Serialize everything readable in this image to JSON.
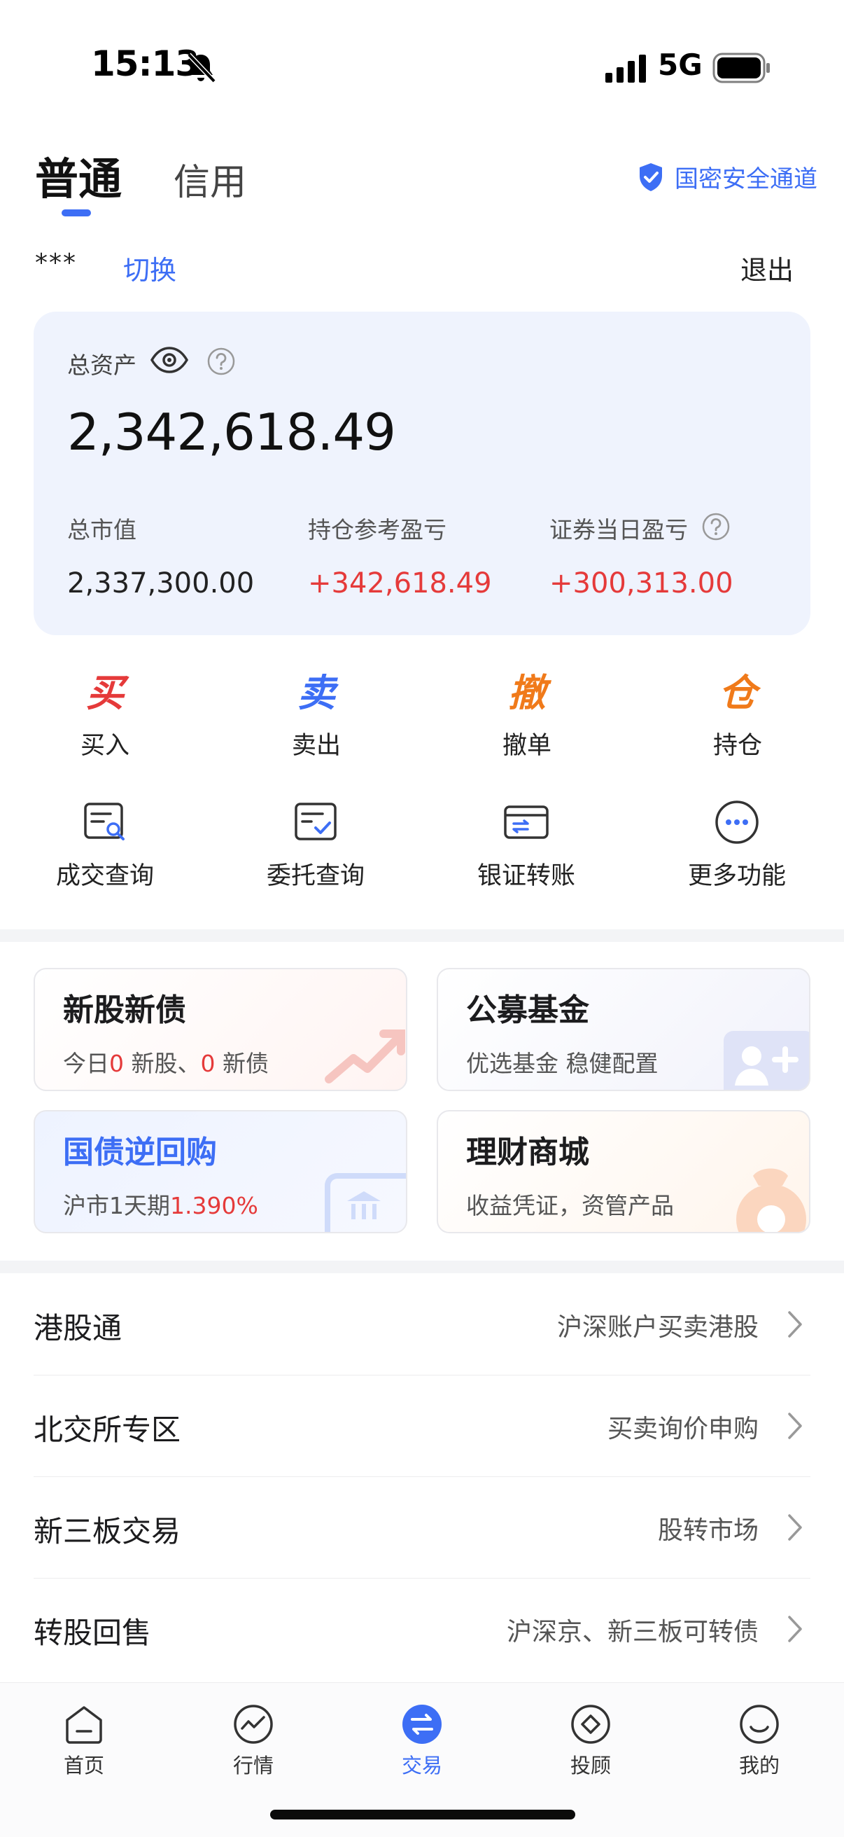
{
  "status_bar": {
    "time": "15:13",
    "network": "5G"
  },
  "header": {
    "tabs": [
      {
        "label": "普通",
        "active": true
      },
      {
        "label": "信用",
        "active": false
      }
    ],
    "secure_label": "国密安全通道"
  },
  "account": {
    "masked": "***",
    "switch_label": "切换",
    "logout_label": "退出"
  },
  "assets": {
    "total_label": "总资产",
    "total_value": "2,342,618.49",
    "metrics": [
      {
        "label": "总市值",
        "value": "2,337,300.00"
      },
      {
        "label": "持仓参考盈亏",
        "value": "+342,618.49"
      },
      {
        "label": "证券当日盈亏",
        "value": "+300,313.00"
      }
    ]
  },
  "trade_actions": [
    {
      "glyph": "买",
      "label": "买入",
      "color": "#e53a3a"
    },
    {
      "glyph": "卖",
      "label": "卖出",
      "color": "#3d6ef5"
    },
    {
      "glyph": "撤",
      "label": "撤单",
      "color": "#f07a1a"
    },
    {
      "glyph": "仓",
      "label": "持仓",
      "color": "#f07a1a"
    }
  ],
  "functions": [
    {
      "label": "成交查询",
      "icon": "deal-search-icon"
    },
    {
      "label": "委托查询",
      "icon": "order-check-icon"
    },
    {
      "label": "银证转账",
      "icon": "transfer-card-icon"
    },
    {
      "label": "更多功能",
      "icon": "more-dots-icon"
    }
  ],
  "feature_cards": {
    "ipo": {
      "title": "新股新债",
      "prefix": "今日",
      "stock_count": "0",
      "stock_label": " 新股、",
      "bond_count": "0",
      "bond_label": " 新债"
    },
    "fund": {
      "title": "公募基金",
      "subtitle": "优选基金 稳健配置"
    },
    "repo": {
      "title": "国债逆回购",
      "prefix": "沪市1天期",
      "rate": "1.390%"
    },
    "mall": {
      "title": "理财商城",
      "subtitle": "收益凭证，资管产品"
    }
  },
  "list_rows": [
    {
      "title": "港股通",
      "subtitle": "沪深账户买卖港股"
    },
    {
      "title": "北交所专区",
      "subtitle": "买卖询价申购"
    },
    {
      "title": "新三板交易",
      "subtitle": "股转市场"
    },
    {
      "title": "转股回售",
      "subtitle": "沪深京、新三板可转债"
    }
  ],
  "bottom_nav": [
    {
      "label": "首页",
      "icon": "home-icon",
      "active": false
    },
    {
      "label": "行情",
      "icon": "market-icon",
      "active": false
    },
    {
      "label": "交易",
      "icon": "trade-icon",
      "active": true
    },
    {
      "label": "投顾",
      "icon": "advisor-icon",
      "active": false
    },
    {
      "label": "我的",
      "icon": "profile-icon",
      "active": false
    }
  ],
  "colors": {
    "accent": "#3d6ef5",
    "up": "#e53a3a",
    "orange": "#f07a1a"
  }
}
